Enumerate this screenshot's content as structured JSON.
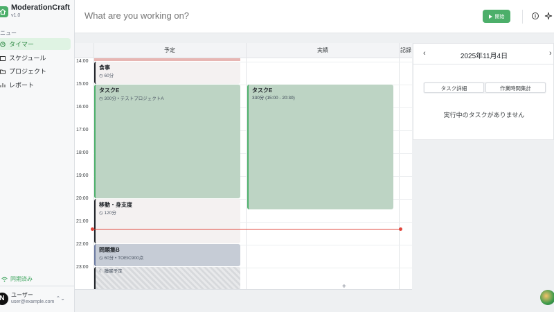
{
  "app": {
    "name": "ModerationCraft",
    "version": "v1.0"
  },
  "sidebar": {
    "menu_header": "ニュー",
    "items": [
      {
        "label": "タイマー",
        "active": true
      },
      {
        "label": "スケジュール",
        "active": false
      },
      {
        "label": "プロジェクト",
        "active": false
      },
      {
        "label": "レポート",
        "active": false
      }
    ],
    "sync_status": "同期済み",
    "user": {
      "initial": "N",
      "name": "ユーザー",
      "email": "user@example.com"
    }
  },
  "topbar": {
    "task_placeholder": "What are you working on?",
    "start_label": "開始",
    "accent": "#4caf6a"
  },
  "calendar": {
    "columns": {
      "plan": "予定",
      "actual": "実績",
      "record": "記録"
    },
    "hours": [
      "14:00",
      "15:00",
      "16:00",
      "17:00",
      "18:00",
      "19:00",
      "20:00",
      "21:00",
      "22:00",
      "23:00"
    ],
    "plan_blocks": [
      {
        "title": "食事",
        "meta": "60分"
      },
      {
        "title": "タスクE",
        "meta": "300分 • テストプロジェクトA"
      },
      {
        "title": "移動・身支度",
        "meta": "120分"
      },
      {
        "title": "問題集B",
        "meta": "60分 • TOEIC900点"
      },
      {
        "title": "睡眠予定",
        "meta": ""
      }
    ],
    "actual_blocks": [
      {
        "title": "タスクE",
        "meta": "330分 (15:00 - 20:30)"
      }
    ],
    "now_color": "#e0453b"
  },
  "panel": {
    "date": "2025年11月4日",
    "tabs": [
      "タスク詳細",
      "作業時間集計"
    ],
    "empty_text": "実行中のタスクがありません"
  }
}
